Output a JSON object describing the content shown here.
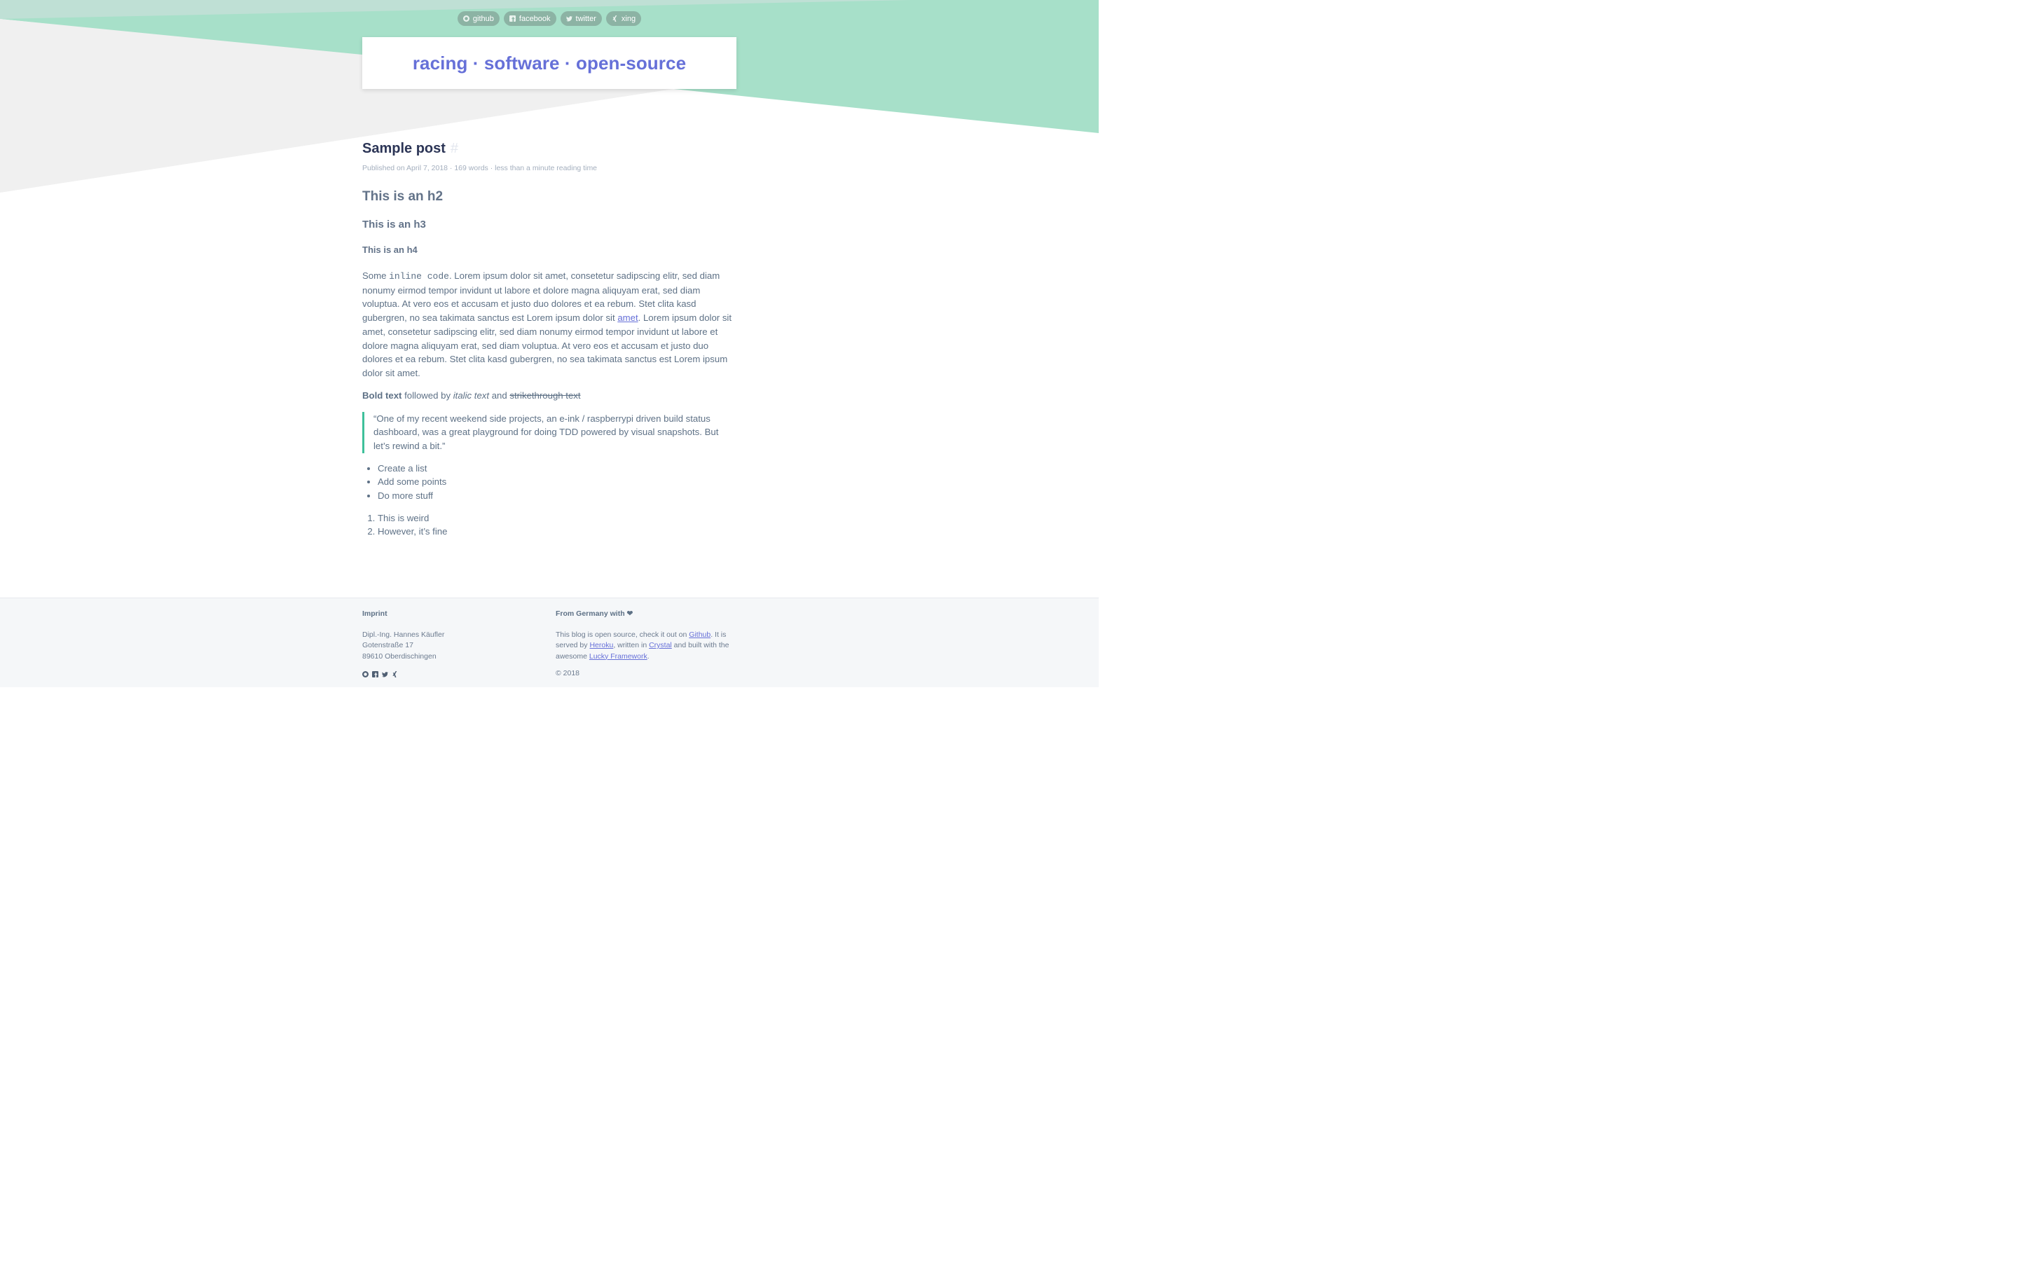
{
  "colors": {
    "accent": "#6670d8",
    "teal": "#3ec09a",
    "bg_mint": "#a7e0c9",
    "bg_gray": "#f0f0f0"
  },
  "social_nav": [
    {
      "label": "github",
      "icon": "github-icon"
    },
    {
      "label": "facebook",
      "icon": "facebook-icon"
    },
    {
      "label": "twitter",
      "icon": "twitter-icon"
    },
    {
      "label": "xing",
      "icon": "xing-icon"
    }
  ],
  "header": {
    "title": "racing · software · open-source"
  },
  "post": {
    "title": "Sample post",
    "anchor": "#",
    "meta": "Published on April 7, 2018 · 169 words · less than a minute reading time",
    "h2": "This is an h2",
    "h3": "This is an h3",
    "h4": "This is an h4",
    "para_prefix": "Some ",
    "inline_code": "inline code",
    "para_part1": ". Lorem ipsum dolor sit amet, consetetur sadipscing elitr, sed diam nonumy eirmod tempor invidunt ut labore et dolore magna aliquyam erat, sed diam voluptua. At vero eos et accusam et justo duo dolores et ea rebum. Stet clita kasd gubergren, no sea takimata sanctus est Lorem ipsum dolor sit ",
    "para_link": "amet",
    "para_part2": ". Lorem ipsum dolor sit amet, consetetur sadipscing elitr, sed diam nonumy eirmod tempor invidunt ut labore et dolore magna aliquyam erat, sed diam voluptua. At vero eos et accusam et justo duo dolores et ea rebum. Stet clita kasd gubergren, no sea takimata sanctus est Lorem ipsum dolor sit amet.",
    "bold": "Bold text",
    "followed_by": " followed by ",
    "italic": "italic text",
    "and": " and ",
    "strike": "strikethrough text",
    "quote": "“One of my recent weekend side projects, an e-ink / raspberrypi driven build status dashboard, was a great playground for doing TDD powered by visual snapshots. But let’s rewind a bit.”",
    "bullets": [
      "Create a list",
      "Add some points",
      "Do more stuff"
    ],
    "numbered": [
      "This is weird",
      "However, it’s fine"
    ]
  },
  "footer": {
    "imprint_heading": "Imprint",
    "address": [
      "Dipl.-Ing. Hannes Käufler",
      "Gotenstraße 17",
      "89610 Oberdischingen"
    ],
    "icons": [
      "github-icon",
      "facebook-icon",
      "twitter-icon",
      "xing-icon"
    ],
    "right_heading": "From Germany with ❤",
    "blurb_1": "This blog is open source, check it out on ",
    "link_github": "Github",
    "blurb_2": ". It is served by ",
    "link_heroku": "Heroku",
    "blurb_3": ", written in ",
    "link_crystal": "Crystal",
    "blurb_4": " and built with the awesome ",
    "link_lucky": "Lucky Framework",
    "blurb_5": ".",
    "copyright": "© 2018"
  }
}
